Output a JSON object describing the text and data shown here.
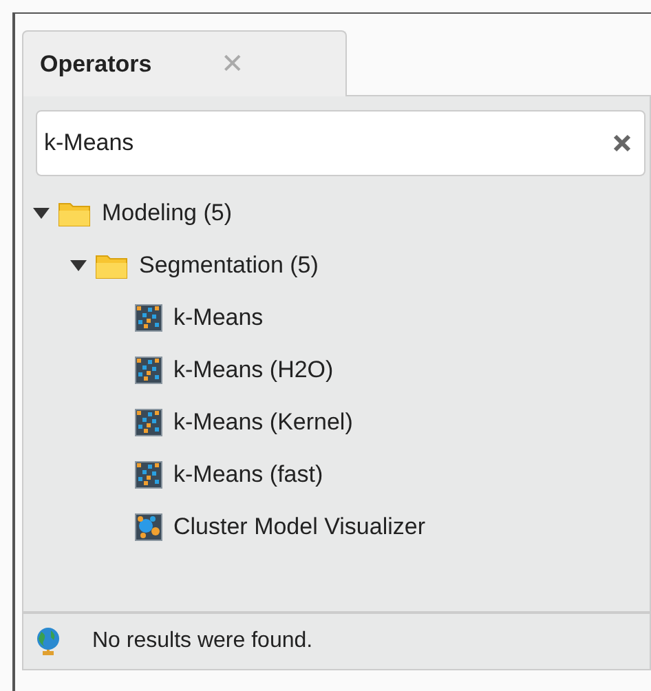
{
  "tabs": [
    {
      "label": "Operators",
      "close": "✕",
      "selected": true
    }
  ],
  "search": {
    "value": "k-Means"
  },
  "tree": [
    {
      "label": "Modeling (5)",
      "kind": "folder",
      "expanded": true,
      "children": [
        {
          "label": "Segmentation (5)",
          "kind": "folder",
          "expanded": true,
          "children": [
            {
              "label": "k-Means",
              "kind": "operator"
            },
            {
              "label": "k-Means (H2O)",
              "kind": "operator"
            },
            {
              "label": "k-Means (Kernel)",
              "kind": "operator"
            },
            {
              "label": "k-Means (fast)",
              "kind": "operator"
            },
            {
              "label": "Cluster Model Visualizer",
              "kind": "visualizer"
            }
          ]
        }
      ]
    }
  ],
  "status": {
    "message": "No results were found."
  }
}
